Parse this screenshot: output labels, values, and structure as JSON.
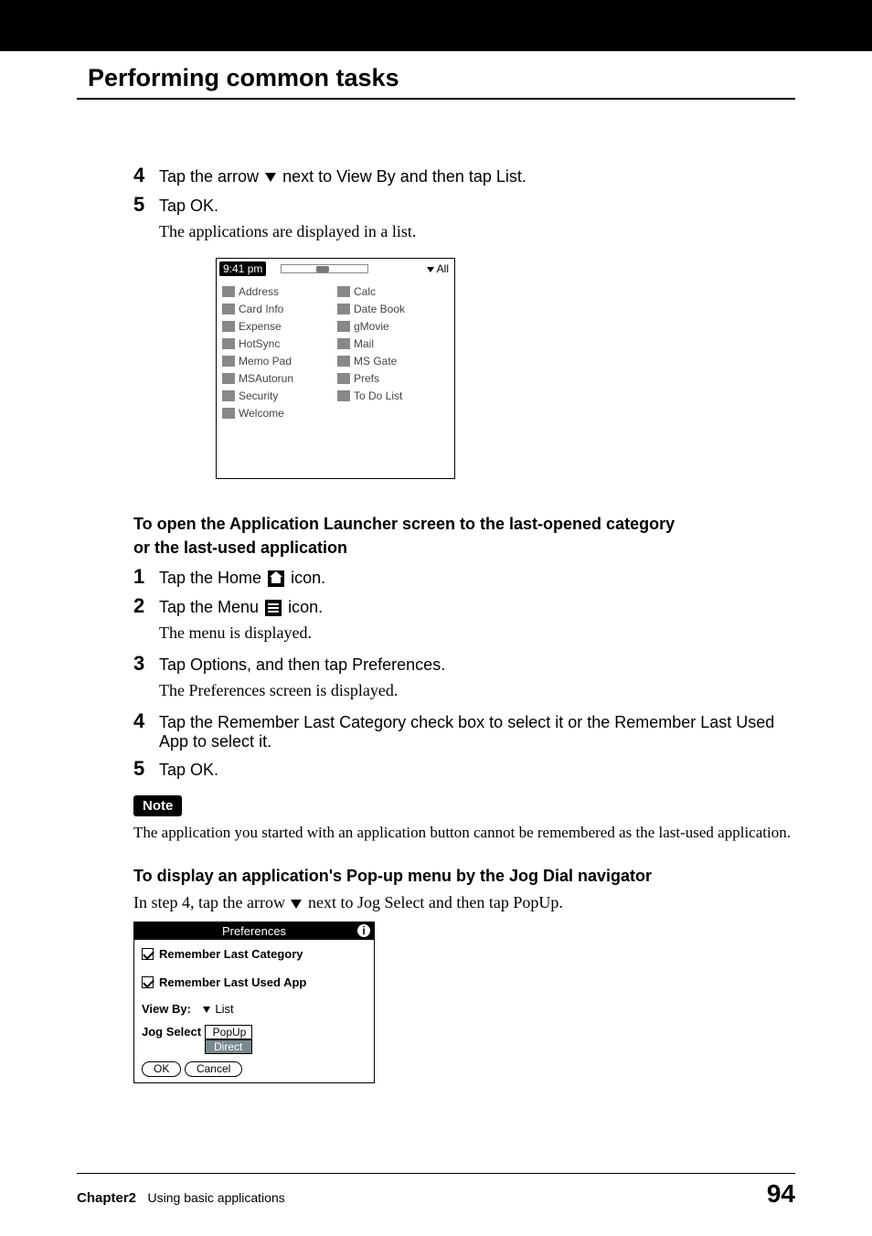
{
  "section_title": "Performing common tasks",
  "step4": {
    "num": "4",
    "text_pre": "Tap the arrow ",
    "text_post": " next to View By and then tap List."
  },
  "step5": {
    "num": "5",
    "text": "Tap OK.",
    "sub": "The applications are displayed in a list."
  },
  "launcher": {
    "time": "9:41 pm",
    "category": "All",
    "apps_col1": [
      "Address",
      "Card Info",
      "Expense",
      "HotSync",
      "Memo Pad",
      "MSAutorun",
      "Security",
      "Welcome"
    ],
    "apps_col2": [
      "Calc",
      "Date Book",
      "gMovie",
      "Mail",
      "MS Gate",
      "Prefs",
      "To Do List"
    ]
  },
  "sub_heading_1a": "To open the Application Launcher screen to the last-opened category",
  "sub_heading_1b": "or the last-used application",
  "inner_steps": {
    "s1": {
      "num": "1",
      "pre": "Tap the Home ",
      "post": " icon."
    },
    "s2": {
      "num": "2",
      "pre": "Tap the Menu ",
      "post": " icon.",
      "sub": "The menu is displayed."
    },
    "s3": {
      "num": "3",
      "text": "Tap Options, and then tap Preferences.",
      "sub": "The Preferences screen is displayed."
    },
    "s4": {
      "num": "4",
      "text": "Tap the Remember Last Category check box to select it or the Remember Last Used App to select it."
    },
    "s5": {
      "num": "5",
      "text": "Tap OK."
    }
  },
  "note_label": "Note",
  "note_body": "The application you started with an application button cannot be remembered as the last-used application.",
  "sub_heading_2": "To display an application's Pop-up menu by the Jog Dial navigator",
  "sub2_body_pre": " In step 4, tap the arrow ",
  "sub2_body_post": " next to Jog Select and then tap PopUp.",
  "prefs": {
    "title": "Preferences",
    "chk1": "Remember Last Category",
    "chk2": "Remember Last Used App",
    "viewby_label": "View By:",
    "viewby_value": "List",
    "jogselect_label": "Jog Select",
    "jog_opt1": "PopUp",
    "jog_opt2": "Direct",
    "ok": "OK",
    "cancel": "Cancel"
  },
  "footer": {
    "chapter_label": "Chapter2",
    "chapter_text": "Using basic applications",
    "page": "94"
  }
}
